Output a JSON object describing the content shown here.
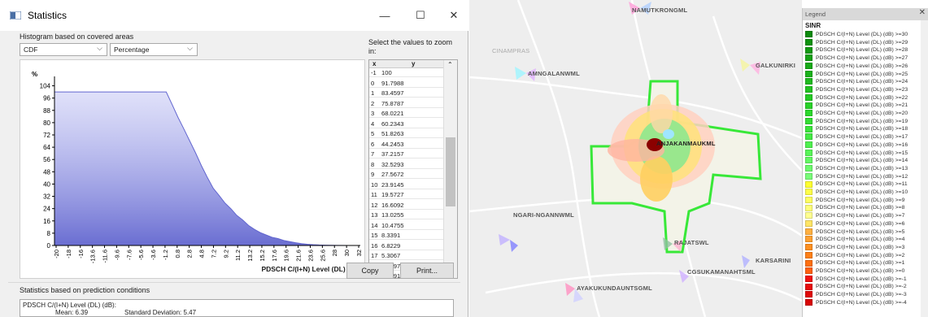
{
  "window": {
    "title": "Statistics",
    "minimize": "—",
    "maximize": "☐",
    "close": "✕"
  },
  "histogram_label": "Histogram based on covered areas",
  "mode_select": {
    "value": "CDF"
  },
  "unit_select": {
    "value": "Percentage"
  },
  "zoom_label": "Select the values to zoom in:",
  "table": {
    "headers": [
      "x",
      "y"
    ],
    "rows": [
      [
        "-1",
        "100"
      ],
      [
        "0",
        "91.7988"
      ],
      [
        "1",
        "83.4597"
      ],
      [
        "2",
        "75.8787"
      ],
      [
        "3",
        "68.0221"
      ],
      [
        "4",
        "60.2343"
      ],
      [
        "5",
        "51.8263"
      ],
      [
        "6",
        "44.2453"
      ],
      [
        "7",
        "37.2157"
      ],
      [
        "8",
        "32.5293"
      ],
      [
        "9",
        "27.5672"
      ],
      [
        "10",
        "23.9145"
      ],
      [
        "11",
        "19.5727"
      ],
      [
        "12",
        "16.6092"
      ],
      [
        "13",
        "13.0255"
      ],
      [
        "14",
        "10.4755"
      ],
      [
        "15",
        "8.3391"
      ],
      [
        "16",
        "6.8229"
      ],
      [
        "17",
        "5.3067"
      ],
      [
        "18",
        "4.4797"
      ],
      [
        "19",
        "3.2391"
      ]
    ]
  },
  "buttons": {
    "copy": "Copy",
    "print": "Print..."
  },
  "stats_label": "Statistics based on prediction conditions",
  "stats_text": {
    "line1": "PDSCH C/(I+N) Level (DL) (dB):",
    "mean": "Mean: 6.39",
    "std": "Standard Deviation: 5.47"
  },
  "chart_data": {
    "type": "area",
    "ylabel": "%",
    "xlabel": "PDSCH C/(I+N) Level (DL) (dB)",
    "ylim": [
      0,
      108
    ],
    "yticks": [
      0,
      8,
      16,
      24,
      32,
      40,
      48,
      56,
      64,
      72,
      80,
      88,
      96,
      104
    ],
    "xtick_labels": [
      "-20",
      "-18",
      "-16",
      "-13.6",
      "-11.6",
      "-9.6",
      "-7.6",
      "-5.6",
      "-3.6",
      "-1.2",
      "0.8",
      "2.8",
      "4.8",
      "7.2",
      "9.2",
      "11.2",
      "13.2",
      "15.2",
      "17.6",
      "19.6",
      "21.6",
      "23.6",
      "25.6",
      "28",
      "30",
      "32"
    ],
    "x": [
      -20,
      -18,
      -16,
      -14,
      -12,
      -10,
      -8,
      -6,
      -4,
      -2,
      -1,
      0,
      1,
      2,
      3,
      4,
      5,
      6,
      7,
      8,
      9,
      10,
      11,
      12,
      13,
      14,
      15,
      16,
      17,
      18,
      19,
      20,
      21,
      22,
      23,
      24,
      25,
      26,
      27,
      28,
      30,
      32
    ],
    "y": [
      100,
      100,
      100,
      100,
      100,
      100,
      100,
      100,
      100,
      100,
      100,
      91.8,
      83.46,
      75.88,
      68.02,
      60.23,
      51.83,
      44.25,
      37.22,
      32.53,
      27.57,
      23.91,
      19.57,
      16.61,
      13.03,
      10.48,
      8.34,
      6.82,
      5.31,
      4.48,
      3.24,
      2.5,
      1.8,
      1.2,
      0.8,
      0.5,
      0.3,
      0.2,
      0.1,
      0.05,
      0,
      0
    ],
    "fill_color": "#a5a8ee",
    "line_color": "#6266cf"
  },
  "map": {
    "labels": [
      "NAMUTKRONGML",
      "CINAMPRAS",
      "AMNGALANWML",
      "GALKUNIRKI",
      "ANJAKANMAUKML",
      "NGARI-NGANNWML",
      "RAJATSWL",
      "CGSUKAMANAHTSML",
      "KARSARINI",
      "AYAKUKUNDAUNTSGML"
    ]
  },
  "legend": {
    "header": "Legend",
    "close": "✕",
    "title": "SINR",
    "items": [
      {
        "label": "PDSCH C/(I+N) Level (DL) (dB) >=30",
        "color": "#0c8a0c"
      },
      {
        "label": "PDSCH C/(I+N) Level (DL) (dB) >=29",
        "color": "#0f920f"
      },
      {
        "label": "PDSCH C/(I+N) Level (DL) (dB) >=28",
        "color": "#129a12"
      },
      {
        "label": "PDSCH C/(I+N) Level (DL) (dB) >=27",
        "color": "#15a215"
      },
      {
        "label": "PDSCH C/(I+N) Level (DL) (dB) >=26",
        "color": "#18aa18"
      },
      {
        "label": "PDSCH C/(I+N) Level (DL) (dB) >=25",
        "color": "#1bb21b"
      },
      {
        "label": "PDSCH C/(I+N) Level (DL) (dB) >=24",
        "color": "#1eba1e"
      },
      {
        "label": "PDSCH C/(I+N) Level (DL) (dB) >=23",
        "color": "#21c221"
      },
      {
        "label": "PDSCH C/(I+N) Level (DL) (dB) >=22",
        "color": "#24ca24"
      },
      {
        "label": "PDSCH C/(I+N) Level (DL) (dB) >=21",
        "color": "#28d228"
      },
      {
        "label": "PDSCH C/(I+N) Level (DL) (dB) >=20",
        "color": "#2cd82c"
      },
      {
        "label": "PDSCH C/(I+N) Level (DL) (dB) >=19",
        "color": "#33de33"
      },
      {
        "label": "PDSCH C/(I+N) Level (DL) (dB) >=18",
        "color": "#3be43b"
      },
      {
        "label": "PDSCH C/(I+N) Level (DL) (dB) >=17",
        "color": "#44ea44"
      },
      {
        "label": "PDSCH C/(I+N) Level (DL) (dB) >=16",
        "color": "#4ef04e"
      },
      {
        "label": "PDSCH C/(I+N) Level (DL) (dB) >=15",
        "color": "#58f558"
      },
      {
        "label": "PDSCH C/(I+N) Level (DL) (dB) >=14",
        "color": "#62f862"
      },
      {
        "label": "PDSCH C/(I+N) Level (DL) (dB) >=13",
        "color": "#6cfa6c"
      },
      {
        "label": "PDSCH C/(I+N) Level (DL) (dB) >=12",
        "color": "#78fc78"
      },
      {
        "label": "PDSCH C/(I+N) Level (DL) (dB) >=11",
        "color": "#ffff30"
      },
      {
        "label": "PDSCH C/(I+N) Level (DL) (dB) >=10",
        "color": "#ffff48"
      },
      {
        "label": "PDSCH C/(I+N) Level (DL) (dB) >=9",
        "color": "#ffff60"
      },
      {
        "label": "PDSCH C/(I+N) Level (DL) (dB) >=8",
        "color": "#ffff78"
      },
      {
        "label": "PDSCH C/(I+N) Level (DL) (dB) >=7",
        "color": "#ffff90"
      },
      {
        "label": "PDSCH C/(I+N) Level (DL) (dB) >=6",
        "color": "#ffe566"
      },
      {
        "label": "PDSCH C/(I+N) Level (DL) (dB) >=5",
        "color": "#ffb040"
      },
      {
        "label": "PDSCH C/(I+N) Level (DL) (dB) >=4",
        "color": "#ffa030"
      },
      {
        "label": "PDSCH C/(I+N) Level (DL) (dB) >=3",
        "color": "#ff9020"
      },
      {
        "label": "PDSCH C/(I+N) Level (DL) (dB) >=2",
        "color": "#ff8018"
      },
      {
        "label": "PDSCH C/(I+N) Level (DL) (dB) >=1",
        "color": "#ff7010"
      },
      {
        "label": "PDSCH C/(I+N) Level (DL) (dB) >=0",
        "color": "#ff6010"
      },
      {
        "label": "PDSCH C/(I+N) Level (DL) (dB) >=-1",
        "color": "#f01010"
      },
      {
        "label": "PDSCH C/(I+N) Level (DL) (dB) >=-2",
        "color": "#e80c0c"
      },
      {
        "label": "PDSCH C/(I+N) Level (DL) (dB) >=-3",
        "color": "#e00808"
      },
      {
        "label": "PDSCH C/(I+N) Level (DL) (dB) >=-4",
        "color": "#d80404"
      }
    ]
  }
}
